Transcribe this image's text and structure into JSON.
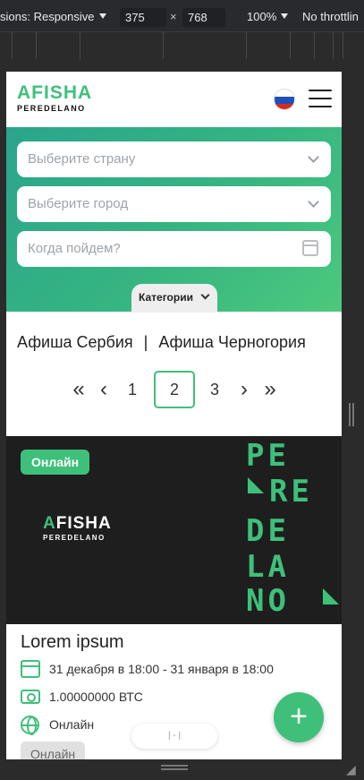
{
  "devtools": {
    "dimensions_label": "sions: Responsive",
    "width": "375",
    "times": "×",
    "height": "768",
    "zoom": "100%",
    "throttling": "No throttlin"
  },
  "header": {
    "logo_top": "AFISHA",
    "logo_bottom": "PEREDELANO",
    "flag_colors": [
      "#ffffff",
      "#1f4fb8",
      "#d52b1e"
    ]
  },
  "filters": {
    "country_placeholder": "Выберите страну",
    "city_placeholder": "Выберите город",
    "date_placeholder": "Когда пойдем?",
    "categories_label": "Категории"
  },
  "links": {
    "serbia": "Афиша Сербия",
    "separator": "|",
    "montenegro": "Афиша Черногория"
  },
  "pagination": {
    "first": "«",
    "prev": "‹",
    "pages": [
      "1",
      "2",
      "3"
    ],
    "current": "2",
    "next": "›",
    "last": "»"
  },
  "card": {
    "badge": "Онлайн",
    "banner_logo_a": "A",
    "banner_logo_rest": "FISHA",
    "banner_logo_bottom": "PEREDELANO",
    "banner_tiles": [
      "PE",
      "RE",
      "DE",
      "LA",
      "NO"
    ],
    "title": "Lorem ipsum",
    "date": "31 декабря в 18:00 - 31 января в 18:00",
    "price": "1.00000000 ВТС",
    "location": "Онлайн",
    "chip": "Онлайн"
  },
  "fab_label": "+",
  "pill_text": "|  -  |",
  "colors": {
    "accent": "#3fc07a",
    "gradient_start": "#2aa58c",
    "gradient_end": "#4cc97d",
    "banner_bg": "#1e1e1e"
  }
}
